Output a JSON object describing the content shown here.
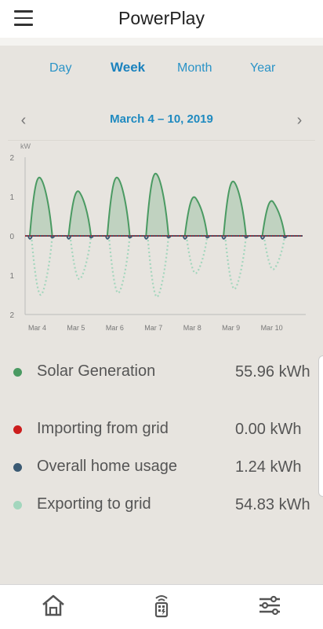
{
  "app": {
    "title": "PowerPlay"
  },
  "tabs": [
    {
      "label": "Day",
      "active": false
    },
    {
      "label": "Week",
      "active": true
    },
    {
      "label": "Month",
      "active": false
    },
    {
      "label": "Year",
      "active": false
    }
  ],
  "date_nav": {
    "label": "March 4 – 10, 2019",
    "prev_icon": "chevron-left-icon",
    "next_icon": "chevron-right-icon"
  },
  "legend": [
    {
      "label": "Solar Generation",
      "value": "55.96 kWh",
      "color": "#4a9a62"
    },
    {
      "label": "Importing from grid",
      "value": "0.00 kWh",
      "color": "#cc1d1d"
    },
    {
      "label": "Overall home usage",
      "value": "1.24 kWh",
      "color": "#3b5a73"
    },
    {
      "label": "Exporting to grid",
      "value": "54.83 kWh",
      "color": "#a3d6bd"
    }
  ],
  "chart_data": {
    "type": "area",
    "unit": "kW",
    "yticks": [
      "2",
      "1",
      "0",
      "1",
      "2"
    ],
    "ylim": [
      -2,
      2
    ],
    "x_ticks": [
      "Mar 4",
      "Mar 5",
      "Mar 6",
      "Mar 7",
      "Mar 8",
      "Mar 9",
      "Mar 10"
    ],
    "series": [
      {
        "name": "Solar Generation",
        "color": "#4a9a62",
        "daily_peak_kw": [
          1.45,
          1.1,
          1.45,
          1.55,
          0.95,
          1.35,
          0.85
        ]
      },
      {
        "name": "Importing from grid",
        "color": "#cc1d1d",
        "daily_peak_kw": [
          0,
          0,
          0,
          0,
          0,
          0,
          0
        ]
      },
      {
        "name": "Overall home usage",
        "color": "#3b5a73",
        "daily_peak_kw": [
          0.15,
          0.15,
          0.15,
          0.15,
          0.15,
          0.15,
          0.15
        ]
      },
      {
        "name": "Exporting to grid",
        "color": "#a3d6bd",
        "daily_peak_kw": [
          -1.5,
          -1.1,
          -1.45,
          -1.55,
          -0.95,
          -1.35,
          -0.85
        ]
      }
    ],
    "grid": false
  },
  "bottom_nav": [
    {
      "name": "home-icon"
    },
    {
      "name": "meter-icon"
    },
    {
      "name": "settings-sliders-icon"
    }
  ]
}
